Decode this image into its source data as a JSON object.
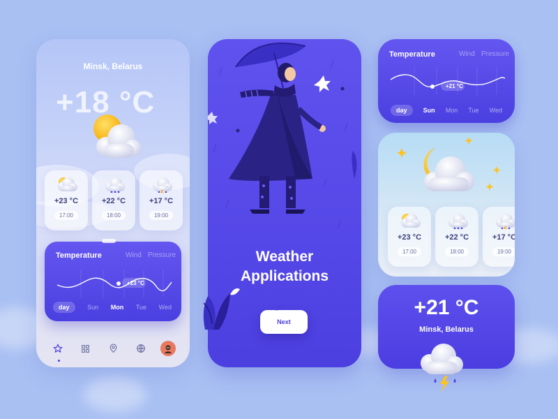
{
  "phone1": {
    "city": "Minsk, Belarus",
    "temperature": "+18 °C",
    "forecast": [
      {
        "icon": "sun-cloud-icon",
        "temp": "+23 °C",
        "time": "17:00"
      },
      {
        "icon": "rain-cloud-icon",
        "temp": "+22 °C",
        "time": "18:00"
      },
      {
        "icon": "storm-cloud-icon",
        "temp": "+17 °C",
        "time": "19:00"
      }
    ],
    "temp_card": {
      "title": "Temperature",
      "tab_wind": "Wind",
      "tab_pressure": "Pressure",
      "marker": "+23 °C",
      "days": [
        "day",
        "Sun",
        "Mon",
        "Tue",
        "Wed"
      ]
    },
    "nav": [
      "star-icon",
      "grid-icon",
      "location-pin-icon",
      "globe-icon",
      "avatar"
    ]
  },
  "phone2": {
    "title_line1": "Weather",
    "title_line2": "Applications",
    "next_label": "Next"
  },
  "right_top": {
    "title": "Temperature",
    "tab_wind": "Wind",
    "tab_pressure": "Pressure",
    "marker": "+21 °C",
    "days": [
      "day",
      "Sun",
      "Mon",
      "Tue",
      "Wed"
    ]
  },
  "right_mid": {
    "forecast": [
      {
        "icon": "sun-cloud-icon",
        "temp": "+23 °C",
        "time": "17:00"
      },
      {
        "icon": "rain-cloud-icon",
        "temp": "+22 °C",
        "time": "18:00"
      },
      {
        "icon": "storm-cloud-icon",
        "temp": "+17 °C",
        "time": "19:00"
      }
    ]
  },
  "right_bottom": {
    "temperature": "+21 °C",
    "city": "Minsk, Belarus"
  },
  "colors": {
    "background": "#a9c0f3",
    "accent": "#4a3fe0",
    "sun": "#ffc21a"
  }
}
